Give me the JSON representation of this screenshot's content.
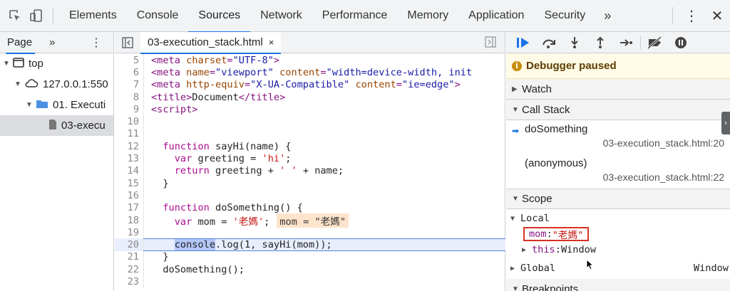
{
  "topbar": {
    "tabs": [
      "Elements",
      "Console",
      "Sources",
      "Network",
      "Performance",
      "Memory",
      "Application",
      "Security"
    ],
    "active_tab": "Sources",
    "more": "»",
    "kebab": "⋮",
    "close": "✕"
  },
  "navigator": {
    "tab": "Page",
    "more": "»",
    "tree": [
      {
        "label": "top"
      },
      {
        "label": "127.0.0.1:550"
      },
      {
        "label": "01. Executi"
      },
      {
        "label": "03-execu"
      }
    ]
  },
  "editor": {
    "filename": "03-execution_stack.html",
    "close": "×",
    "lines": [
      {
        "n": "5"
      },
      {
        "n": "6"
      },
      {
        "n": "7"
      },
      {
        "n": "8"
      },
      {
        "n": "9"
      },
      {
        "n": "10"
      },
      {
        "n": "11"
      },
      {
        "n": "12"
      },
      {
        "n": "13"
      },
      {
        "n": "14"
      },
      {
        "n": "15"
      },
      {
        "n": "16"
      },
      {
        "n": "17"
      },
      {
        "n": "18"
      },
      {
        "n": "19"
      },
      {
        "n": "20"
      },
      {
        "n": "21"
      },
      {
        "n": "22"
      },
      {
        "n": "23"
      }
    ],
    "inline_value": "mom = \"老媽\"",
    "current_line": "20"
  },
  "debugger": {
    "paused": "Debugger paused",
    "watch": "Watch",
    "call_stack": "Call Stack",
    "frames": [
      {
        "name": "doSomething",
        "location": "03-execution_stack.html:20"
      },
      {
        "name": "(anonymous)",
        "location": "03-execution_stack.html:22"
      }
    ],
    "scope": "Scope",
    "local": "Local",
    "local_vars": [
      {
        "name": "mom",
        "value": "\"老媽\""
      },
      {
        "name": "this",
        "value": "Window"
      }
    ],
    "global": "Global",
    "global_value": "Window",
    "breakpoints": "Breakpoints"
  },
  "colors": {
    "accent": "#1a73e8",
    "paused_bg": "#fffbe6",
    "highlight_box": "#d93025"
  }
}
